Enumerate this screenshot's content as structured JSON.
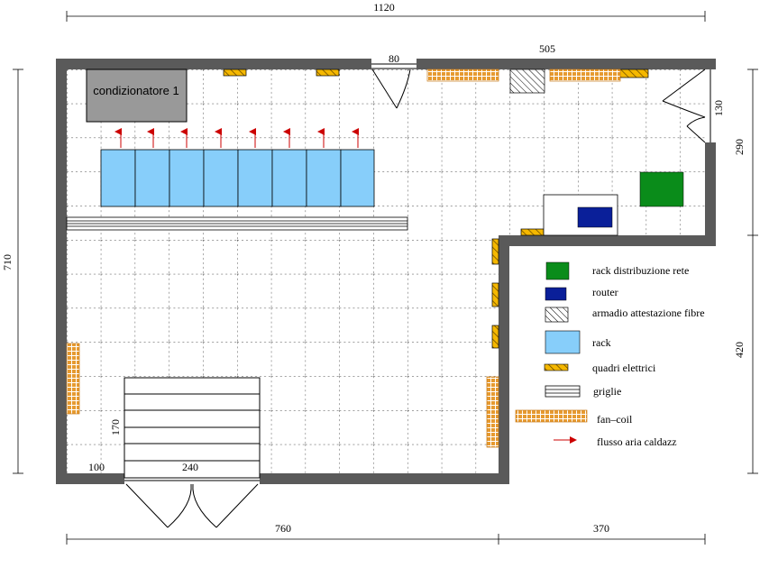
{
  "dimensions": {
    "top_total": "1120",
    "door_top": "80",
    "top_right": "505",
    "right_door": "130",
    "right_upper": "290",
    "right_lower": "420",
    "left_total": "710",
    "bottom_left": "760",
    "bottom_right": "370",
    "door_bottom_left": "100",
    "door_bottom_width": "240",
    "stairs_height": "170"
  },
  "rooms": {
    "ac_unit_label": "condizionatore 1"
  },
  "legend": {
    "items": [
      {
        "key": "rack-distribuzione",
        "label": "rack distribuzione rete",
        "color": "#0a8c1a"
      },
      {
        "key": "router",
        "label": "router",
        "color": "#0a1f99"
      },
      {
        "key": "armadio",
        "label": "armadio attestazione fibre",
        "color": "#ffffff"
      },
      {
        "key": "rack",
        "label": "rack",
        "color": "#87cefa"
      },
      {
        "key": "quadri",
        "label": "quadri elettrici",
        "color": "#f5b800"
      },
      {
        "key": "griglie",
        "label": "griglie",
        "color": "#ffffff"
      },
      {
        "key": "fancoil",
        "label": "fan–coil",
        "color": "#e69a30"
      },
      {
        "key": "flusso",
        "label": "flusso aria caldazz",
        "color": "#cc0000"
      }
    ]
  },
  "colors": {
    "wall": "#5a5a5a",
    "rack": "#87cefa",
    "ac_unit": "#999999",
    "rack_network": "#0a8c1a",
    "router": "#0a1f99",
    "panel": "#f5b800",
    "fancoil": "#e69a30",
    "arrow": "#cc0000"
  }
}
